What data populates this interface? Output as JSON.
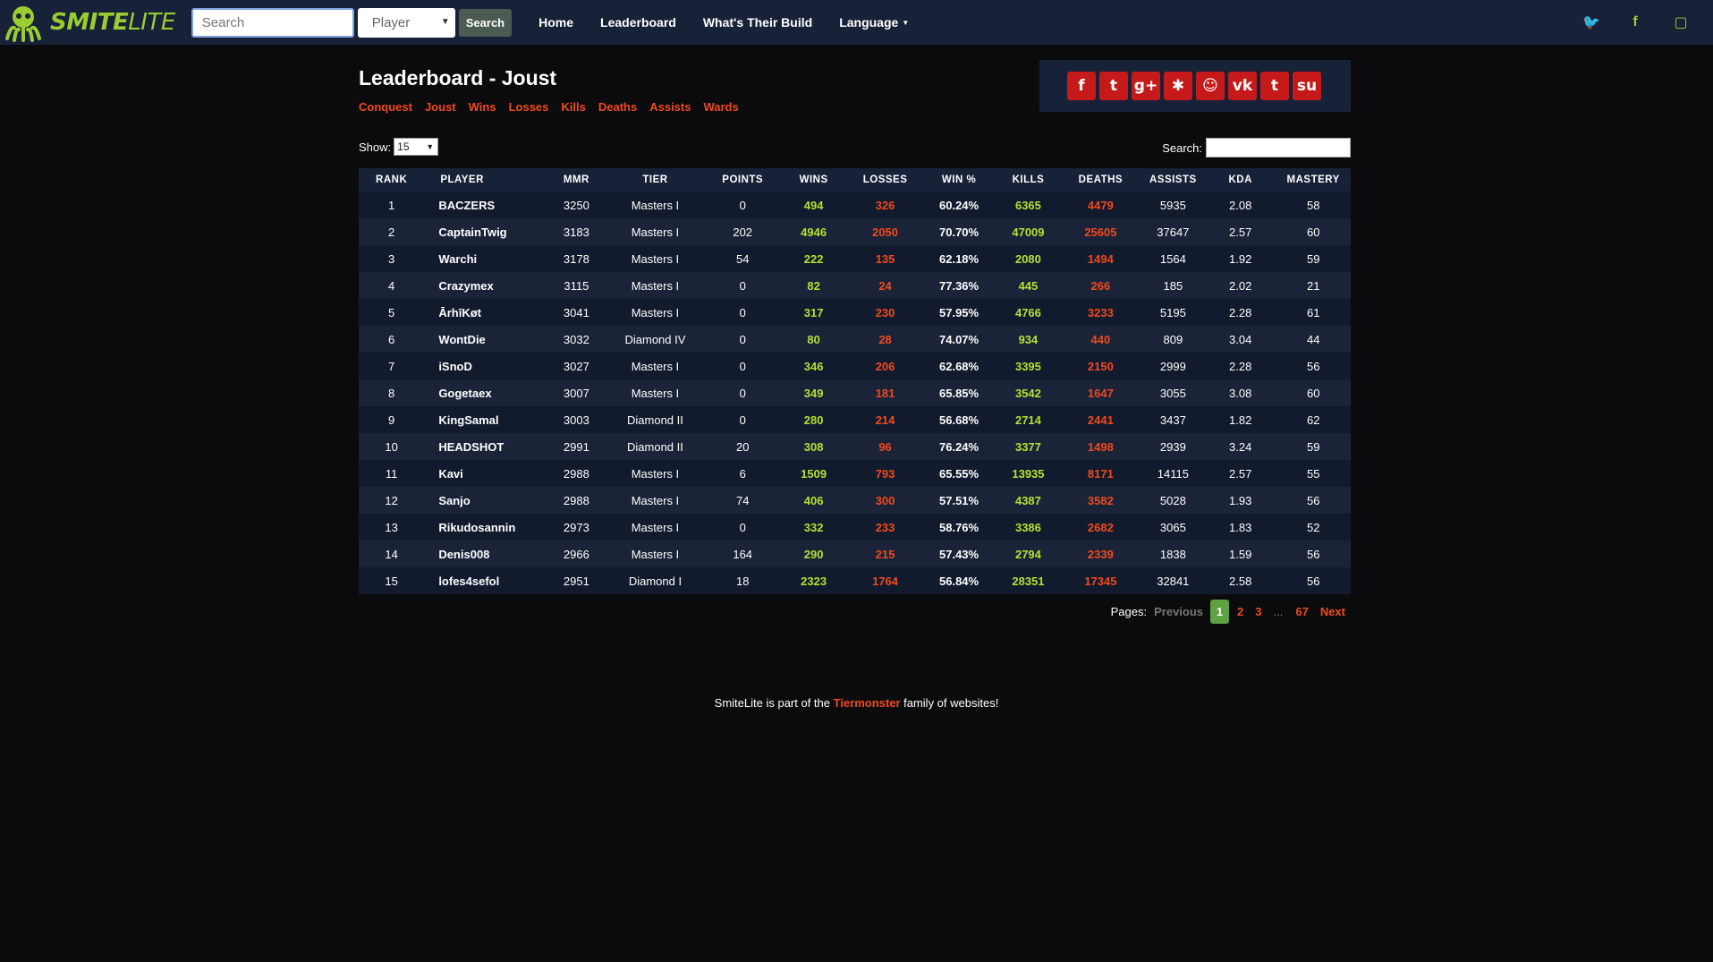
{
  "nav": {
    "logo_smite": "SMITE",
    "logo_lite": "LITE",
    "search_placeholder": "Search",
    "select_value": "Player",
    "search_button": "Search",
    "links": [
      "Home",
      "Leaderboard",
      "What's Their Build",
      "Language"
    ],
    "social_icons": [
      "twitter-icon",
      "facebook-icon",
      "twitch-icon"
    ]
  },
  "page": {
    "title": "Leaderboard - Joust",
    "subnav": [
      "Conquest",
      "Joust",
      "Wins",
      "Losses",
      "Kills",
      "Deaths",
      "Assists",
      "Wards"
    ],
    "share_icons": [
      "facebook-icon",
      "twitter-icon",
      "google-plus-icon",
      "baidu-icon",
      "reddit-icon",
      "vk-icon",
      "tumblr-icon",
      "stumbleupon-icon"
    ],
    "share_glyphs": [
      "f",
      "t",
      "g+",
      "✱",
      "☺",
      "vk",
      "t",
      "su"
    ]
  },
  "controls": {
    "show_label": "Show:",
    "show_value": "15",
    "search_label": "Search:"
  },
  "table": {
    "headers": [
      "RANK",
      "PLAYER",
      "MMR",
      "TIER",
      "POINTS",
      "WINS",
      "LOSSES",
      "WIN %",
      "KILLS",
      "DEATHS",
      "ASSISTS",
      "KDA",
      "MASTERY"
    ],
    "rows": [
      [
        "1",
        "BACZERS",
        "3250",
        "Masters I",
        "0",
        "494",
        "326",
        "60.24%",
        "6365",
        "4479",
        "5935",
        "2.08",
        "58"
      ],
      [
        "2",
        "CaptainTwig",
        "3183",
        "Masters I",
        "202",
        "4946",
        "2050",
        "70.70%",
        "47009",
        "25605",
        "37647",
        "2.57",
        "60"
      ],
      [
        "3",
        "Warchi",
        "3178",
        "Masters I",
        "54",
        "222",
        "135",
        "62.18%",
        "2080",
        "1494",
        "1564",
        "1.92",
        "59"
      ],
      [
        "4",
        "Crazymex",
        "3115",
        "Masters I",
        "0",
        "82",
        "24",
        "77.36%",
        "445",
        "266",
        "185",
        "2.02",
        "21"
      ],
      [
        "5",
        "ĀrhīKøt",
        "3041",
        "Masters I",
        "0",
        "317",
        "230",
        "57.95%",
        "4766",
        "3233",
        "5195",
        "2.28",
        "61"
      ],
      [
        "6",
        "WontDie",
        "3032",
        "Diamond IV",
        "0",
        "80",
        "28",
        "74.07%",
        "934",
        "440",
        "809",
        "3.04",
        "44"
      ],
      [
        "7",
        "iSnoD",
        "3027",
        "Masters I",
        "0",
        "346",
        "206",
        "62.68%",
        "3395",
        "2150",
        "2999",
        "2.28",
        "56"
      ],
      [
        "8",
        "Gogetaex",
        "3007",
        "Masters I",
        "0",
        "349",
        "181",
        "65.85%",
        "3542",
        "1647",
        "3055",
        "3.08",
        "60"
      ],
      [
        "9",
        "KingSamal",
        "3003",
        "Diamond II",
        "0",
        "280",
        "214",
        "56.68%",
        "2714",
        "2441",
        "3437",
        "1.82",
        "62"
      ],
      [
        "10",
        "HEADSHOT",
        "2991",
        "Diamond II",
        "20",
        "308",
        "96",
        "76.24%",
        "3377",
        "1498",
        "2939",
        "3.24",
        "59"
      ],
      [
        "11",
        "Kavi",
        "2988",
        "Masters I",
        "6",
        "1509",
        "793",
        "65.55%",
        "13935",
        "8171",
        "14115",
        "2.57",
        "55"
      ],
      [
        "12",
        "Sanjo",
        "2988",
        "Masters I",
        "74",
        "406",
        "300",
        "57.51%",
        "4387",
        "3582",
        "5028",
        "1.93",
        "56"
      ],
      [
        "13",
        "Rikudosannin",
        "2973",
        "Masters I",
        "0",
        "332",
        "233",
        "58.76%",
        "3386",
        "2682",
        "3065",
        "1.83",
        "52"
      ],
      [
        "14",
        "Denis008",
        "2966",
        "Masters I",
        "164",
        "290",
        "215",
        "57.43%",
        "2794",
        "2339",
        "1838",
        "1.59",
        "56"
      ],
      [
        "15",
        "lofes4sefol",
        "2951",
        "Diamond I",
        "18",
        "2323",
        "1764",
        "56.84%",
        "28351",
        "17345",
        "32841",
        "2.58",
        "56"
      ]
    ]
  },
  "pager": {
    "label": "Pages:",
    "previous": "Previous",
    "current": "1",
    "pages": [
      "2",
      "3"
    ],
    "ellipsis": "...",
    "last": "67",
    "next": "Next"
  },
  "footer": {
    "before": "SmiteLite is part of the ",
    "brand": "Tiermonster",
    "after": " family of websites!"
  },
  "colors": {
    "nav_bg": "#172138",
    "accent_green": "#9acd32",
    "accent_red": "#f04a1c",
    "share_red": "#c61a1a",
    "page_bg": "#0b0b0d"
  }
}
